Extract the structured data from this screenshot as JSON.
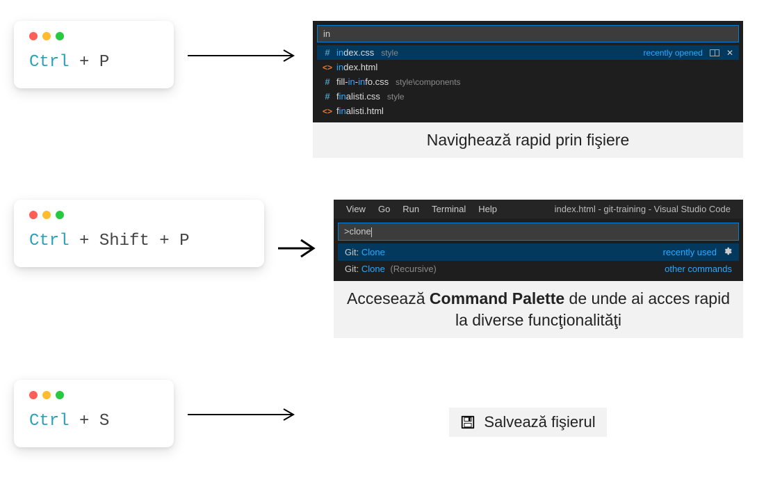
{
  "cards": {
    "ctrlp": {
      "key1": "Ctrl",
      "plus": " + ",
      "key2": "P"
    },
    "ctrlshiftp": {
      "key1": "Ctrl",
      "key2": "Shift",
      "key3": "P",
      "plus": " + "
    },
    "ctrls": {
      "key1": "Ctrl",
      "plus": " + ",
      "key2": "S"
    }
  },
  "quickopen": {
    "search_value": "in",
    "recently_opened": "recently opened",
    "items": [
      {
        "pre": "in",
        "post": "dex.css",
        "path": "style"
      },
      {
        "pre": "in",
        "post": "dex.html",
        "path": ""
      },
      {
        "pre1": "fill-",
        "mid": "in",
        "post1": "-",
        "mid2": "in",
        "post2": "fo.css",
        "path": "style\\components"
      },
      {
        "pre": "f",
        "mid": "in",
        "post": "alisti.css",
        "path": "style"
      },
      {
        "pre": "f",
        "mid": "in",
        "post": "alisti.html",
        "path": ""
      }
    ]
  },
  "palette": {
    "menu": [
      "View",
      "Go",
      "Run",
      "Terminal",
      "Help"
    ],
    "title": "index.html - git-training - Visual Studio Code",
    "input_value": ">clone",
    "recently_used": "recently used",
    "other_commands": "other commands",
    "items": [
      {
        "prefix": "Git: ",
        "match": "Clone",
        "tail": ""
      },
      {
        "prefix": "Git: ",
        "match": "Clone",
        "tail": " (Recursive)"
      }
    ]
  },
  "captions": {
    "c1": "Navighează rapid prin fişiere",
    "c2a": "Accesează ",
    "c2b": "Command Palette",
    "c2c": " de unde ai acces rapid la diverse funcţionalităţi",
    "c3": "Salvează fişierul"
  }
}
